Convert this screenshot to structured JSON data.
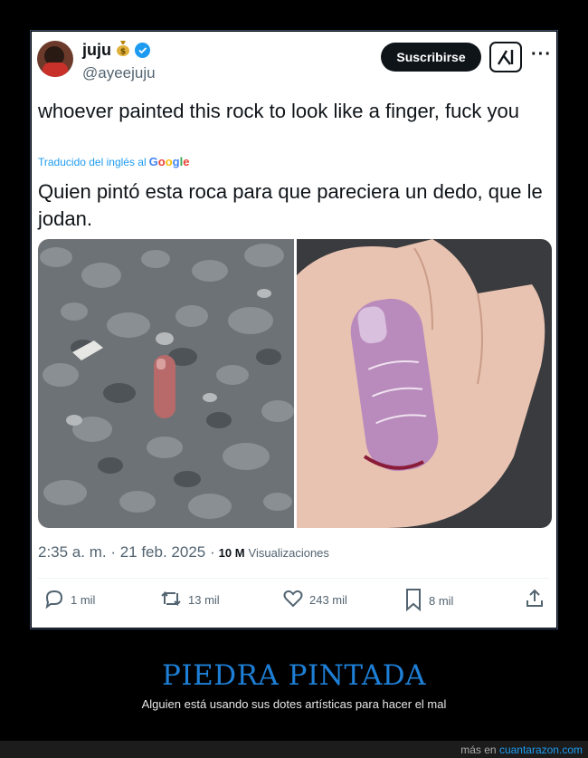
{
  "tweet": {
    "display_name": "juju",
    "handle": "@ayeejuju",
    "subscribe_label": "Suscribirse",
    "text_original": "whoever painted this rock to look like a finger, fuck you",
    "translated_prefix": "Traducido del inglés al",
    "translated_brand": [
      "G",
      "o",
      "o",
      "g",
      "l",
      "e"
    ],
    "text_translated": "Quien pintó esta roca para que pareciera un dedo, que le jodan.",
    "timestamp": "2:35 a. m. · 21 feb. 2025 ·",
    "views_count": "10 M",
    "views_label": "Visualizaciones",
    "actions": {
      "replies": "1 mil",
      "reposts": "13 mil",
      "likes": "243 mil",
      "bookmarks": "8 mil"
    },
    "icons": {
      "name_emoji": "money-bag-icon",
      "verified": "verified-badge-icon",
      "grok": "grok-icon",
      "more": "more-icon"
    },
    "colors": {
      "accent": "#1d9bf0",
      "text": "#0f1419",
      "muted": "#536471"
    }
  },
  "caption": {
    "title": "PIEDRA PINTADA",
    "subtitle": "Alguien está usando sus dotes artísticas para hacer el mal",
    "title_color": "#1e7fd6"
  },
  "footer": {
    "prefix": "más en",
    "site": "cuantarazon.com"
  }
}
